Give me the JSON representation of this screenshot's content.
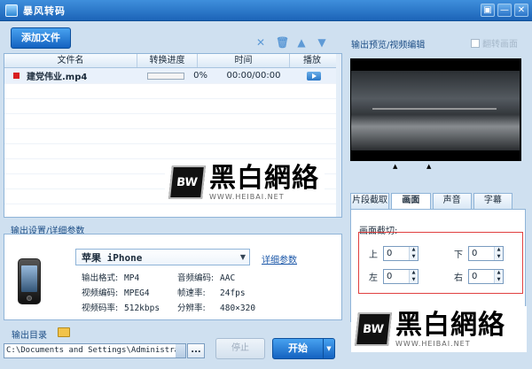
{
  "window": {
    "title": "暴风转码",
    "controls": [
      "▣",
      "—",
      "✕"
    ]
  },
  "toolbar": {
    "add_file": "添加文件",
    "icons": [
      "close-icon",
      "trash-icon",
      "up-arrow-icon",
      "down-arrow-icon"
    ]
  },
  "filelist": {
    "headers": [
      "文件名",
      "转换进度",
      "时间",
      "播放"
    ],
    "rows": [
      {
        "name": "建党伟业.mp4",
        "progress_pct": 0,
        "progress": "0%",
        "time": "00:00/00:00"
      }
    ]
  },
  "settings": {
    "section": "输出设置/详细参数",
    "device": "苹果 iPhone",
    "details_link": "详细参数",
    "params": {
      "format_k": "输出格式:",
      "format_v": "MP4",
      "acodec_k": "音频编码:",
      "acodec_v": "AAC",
      "vcodec_k": "视频编码:",
      "vcodec_v": "MPEG4",
      "fps_k": "帧速率:",
      "fps_v": "24fps",
      "vbitrate_k": "视频码率:",
      "vbitrate_v": "512kbps",
      "res_k": "分辨率:",
      "res_v": "480×320"
    }
  },
  "output": {
    "label": "输出目录",
    "path": "C:\\Documents and Settings\\Administra",
    "browse": "...",
    "stop": "停止",
    "start": "开始"
  },
  "preview": {
    "section": "输出预览/视频编辑",
    "flip": "翻转画面"
  },
  "watermark": {
    "logo": "BW",
    "text": "黑白網絡",
    "url": "WWW.HEIBAI.NET"
  },
  "tabs": [
    {
      "label": "片段截取",
      "active": false
    },
    {
      "label": "画面",
      "active": true
    },
    {
      "label": "声音",
      "active": false
    },
    {
      "label": "字幕",
      "active": false
    }
  ],
  "crop": {
    "title": "画面截切:",
    "top_label": "上",
    "top": "0",
    "bottom_label": "下",
    "bottom": "0",
    "left_label": "左",
    "left": "0",
    "right_label": "右",
    "right": "0"
  },
  "colors": {
    "accent": "#1c64b8",
    "status_red": "#d81e1e",
    "crop_border": "#e04040"
  }
}
